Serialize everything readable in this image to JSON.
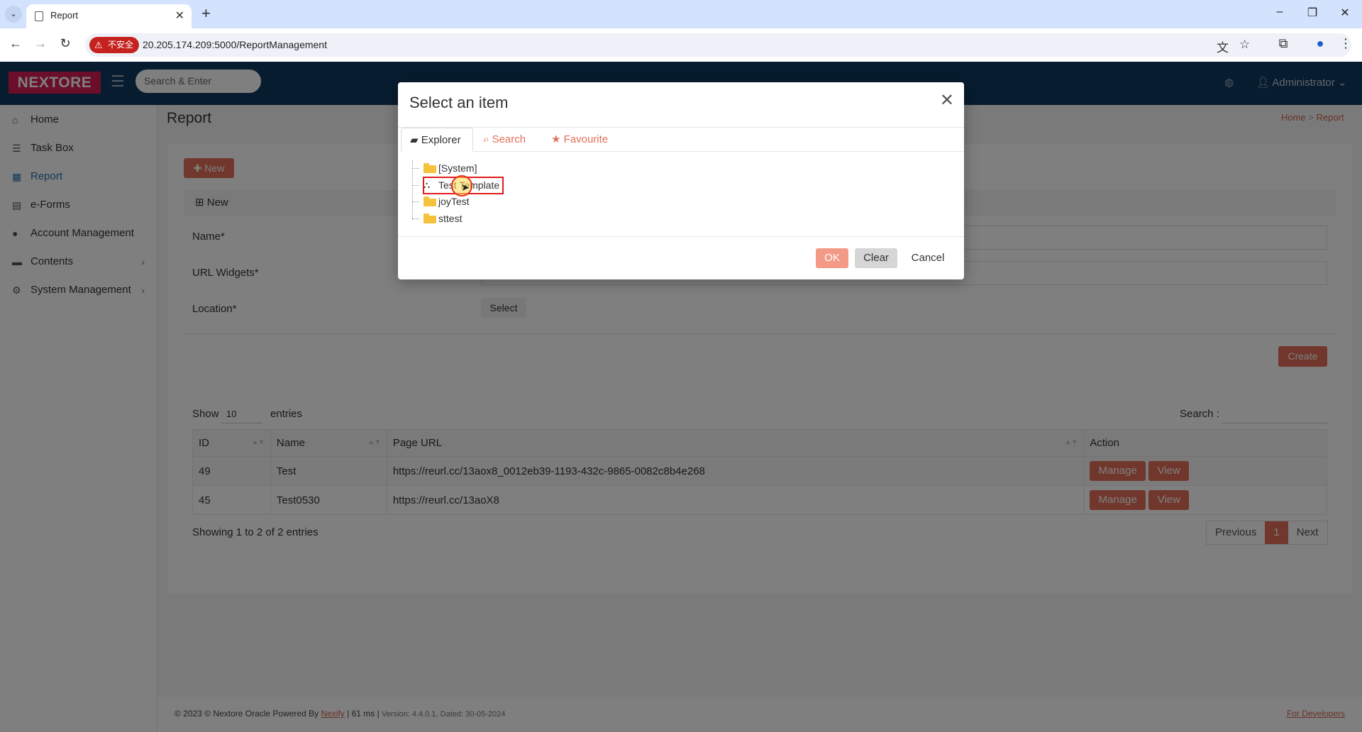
{
  "browser": {
    "tab_title": "Report",
    "insecure_label": "不安全",
    "url": "20.205.174.209:5000/ReportManagement"
  },
  "header": {
    "logo": "NEXTORE",
    "search_placeholder": "Search & Enter",
    "user": "Administrator"
  },
  "sidebar": {
    "items": [
      {
        "label": "Home",
        "icon": "home-icon"
      },
      {
        "label": "Task Box",
        "icon": "task-box-icon"
      },
      {
        "label": "Report",
        "icon": "table-icon"
      },
      {
        "label": "e-Forms",
        "icon": "form-icon"
      },
      {
        "label": "Account Management",
        "icon": "user-icon"
      },
      {
        "label": "Contents",
        "icon": "folder-icon"
      },
      {
        "label": "System Management",
        "icon": "cogs-icon"
      }
    ],
    "active": "Report"
  },
  "page": {
    "title": "Report",
    "breadcrumb": [
      "Home",
      "Report"
    ],
    "new_button": "New",
    "subhead": "New",
    "form": {
      "name_label": "Name*",
      "url_label": "URL Widgets*",
      "location_label": "Location*",
      "select_button": "Select",
      "create_button": "Create"
    },
    "table": {
      "show_label": "Show",
      "entries_value": "10",
      "entries_label": "entries",
      "search_label": "Search :",
      "columns": [
        "ID",
        "Name",
        "Page URL",
        "Action"
      ],
      "rows": [
        {
          "id": "49",
          "name": "Test",
          "url": "https://reurl.cc/13aox8_0012eb39-1193-432c-9865-0082c8b4e268",
          "manage": "Manage",
          "view": "View"
        },
        {
          "id": "45",
          "name": "Test0530",
          "url": "https://reurl.cc/13aoX8",
          "manage": "Manage",
          "view": "View"
        }
      ],
      "showing": "Showing 1 to 2 of 2 entries",
      "pager": {
        "previous": "Previous",
        "current": "1",
        "next": "Next"
      }
    }
  },
  "footer": {
    "copyright": "© 2023 © Nextore Oracle Powered By",
    "powered_link": "Nexify",
    "timing": "| 61 ms |",
    "version": "Version: 4.4.0.1, Dated: 30-05-2024",
    "developers": "For Developers"
  },
  "modal": {
    "title": "Select an item",
    "tabs": [
      "Explorer",
      "Search",
      "Favourite"
    ],
    "tree": [
      {
        "label": "[System]",
        "icon": "folder-icon"
      },
      {
        "label": "Test Template",
        "icon": "sitemap-icon"
      },
      {
        "label": "joyTest",
        "icon": "folder-icon"
      },
      {
        "label": "sttest",
        "icon": "folder-icon"
      }
    ],
    "ok": "OK",
    "clear": "Clear",
    "cancel": "Cancel"
  },
  "colors": {
    "accent": "#e26f5b",
    "header": "#11385f",
    "logo": "#d51d54",
    "highlight": "#e21b1b"
  }
}
